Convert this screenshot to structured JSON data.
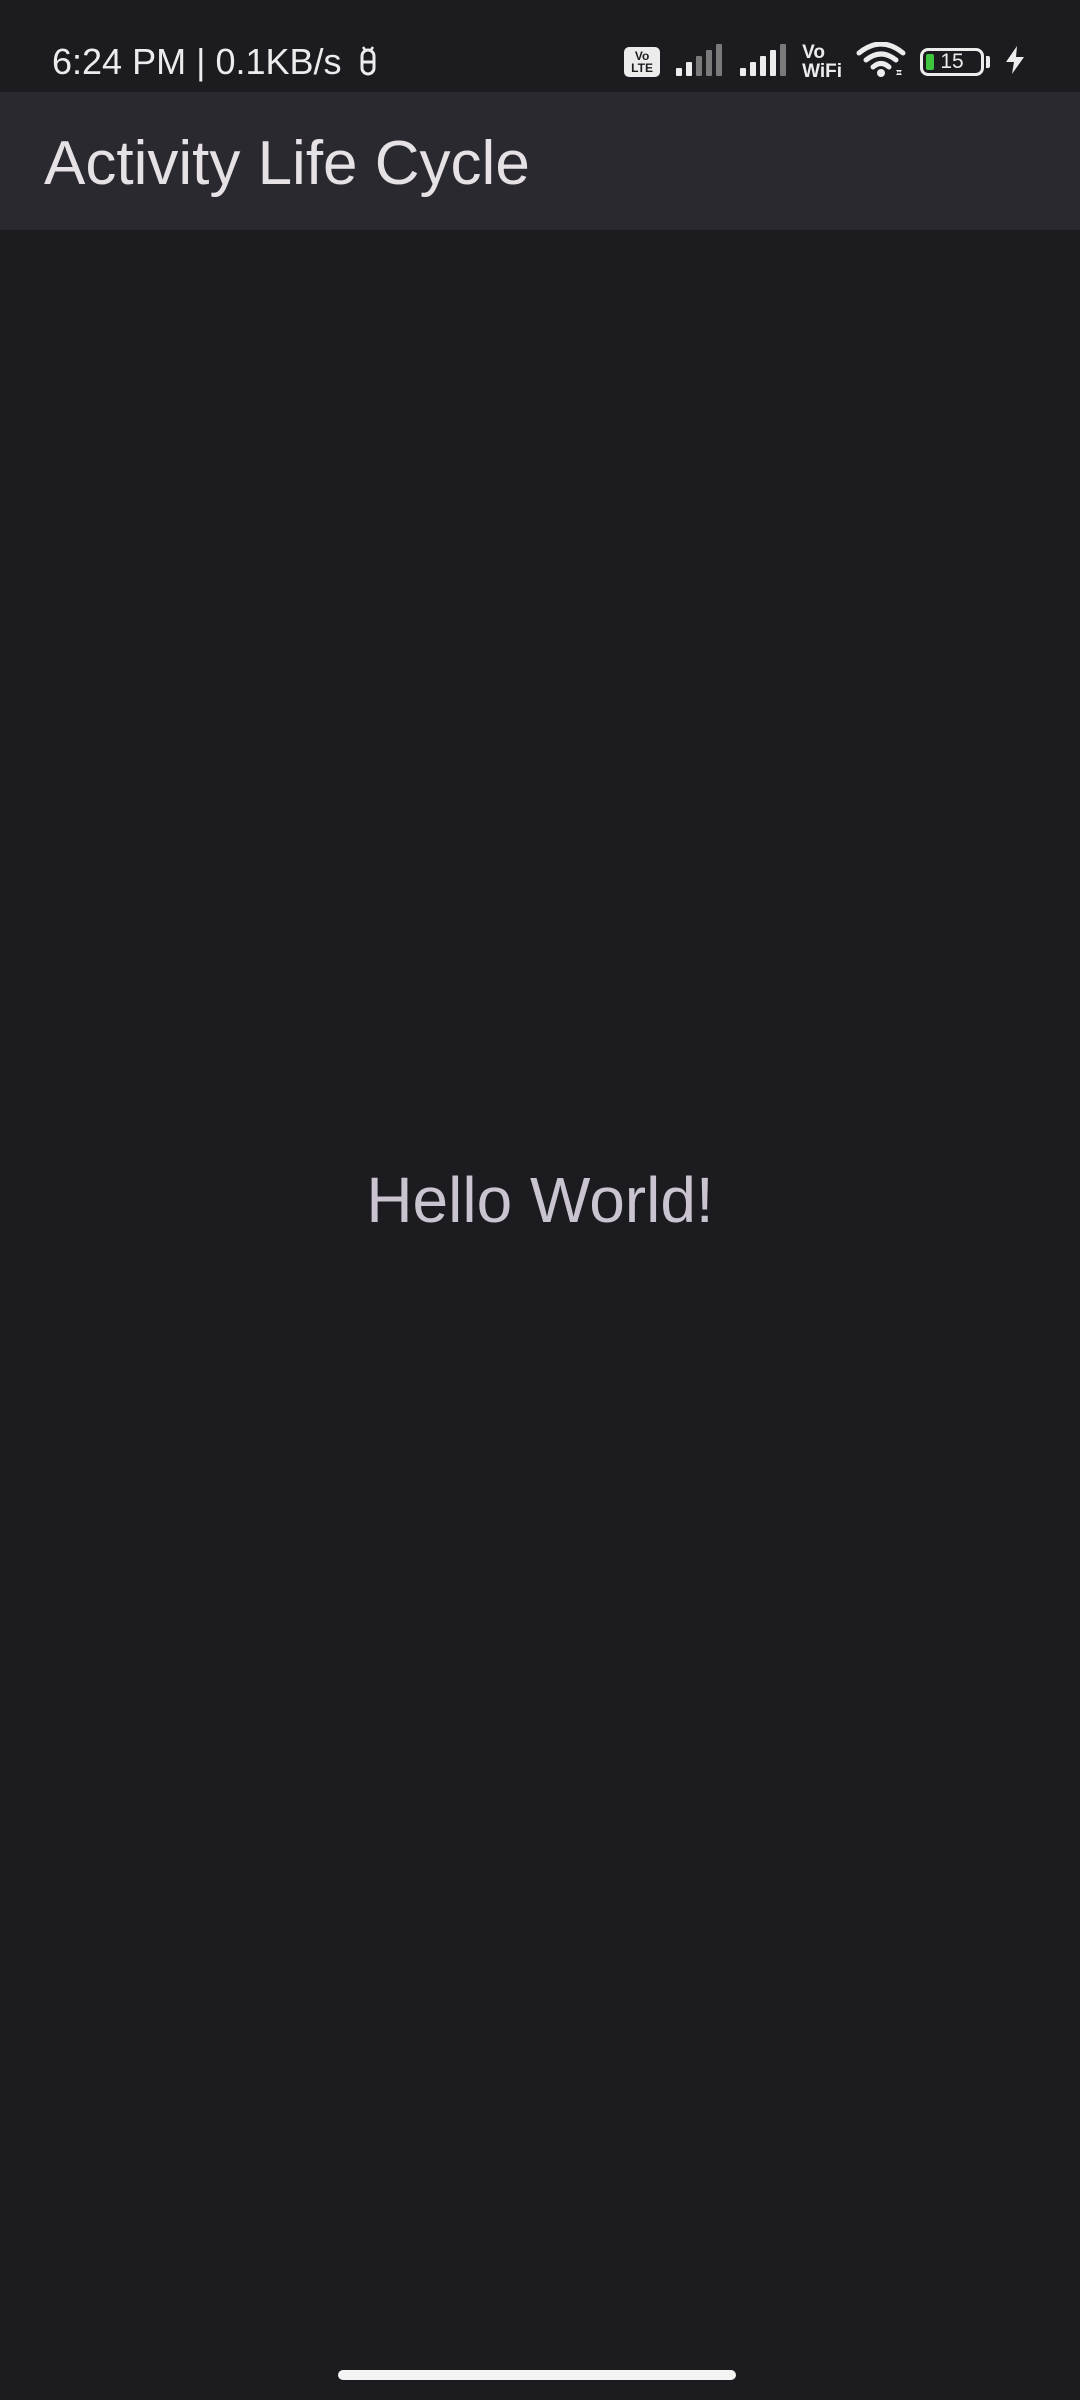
{
  "status_bar": {
    "time": "6:24 PM",
    "separator": "|",
    "net_speed": "0.1KB/s",
    "volte_top": "Vo",
    "volte_bottom": "LTE",
    "vowifi_top": "Vo",
    "vowifi_bottom": "WiFi",
    "battery_level": "15",
    "battery_fraction": 0.15,
    "icons": [
      "notification-icon",
      "volte-icon",
      "signal-icon",
      "signal-icon",
      "vowifi-icon",
      "wifi-icon",
      "battery-icon",
      "charging-icon"
    ]
  },
  "app_bar": {
    "title": "Activity Life Cycle"
  },
  "main": {
    "text": "Hello World!"
  },
  "colors": {
    "background": "#1c1b1f",
    "app_bar": "#2b2930",
    "title_text": "#e6e1e5",
    "body_text": "#cac4d0",
    "battery_fill": "#3ec73e"
  }
}
